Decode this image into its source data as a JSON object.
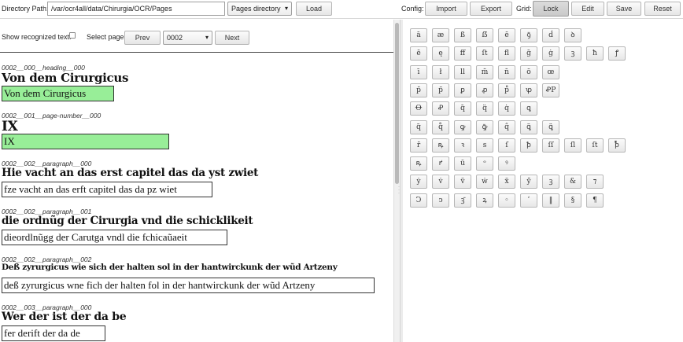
{
  "toolbar": {
    "dir_label": "Directory Path:",
    "dir_value": "/var/ocr4all/data/Chirurgia/OCR/Pages",
    "pages_dir_select": "Pages directory",
    "load_label": "Load",
    "config_label": "Config:",
    "import_label": "Import",
    "export_label": "Export",
    "grid_label": "Grid:",
    "lock_label": "Lock",
    "edit_label": "Edit",
    "save_label": "Save",
    "reset_label": "Reset"
  },
  "controls": {
    "show_recognized_label": "Show recognized text:",
    "select_page_label": "Select page:",
    "prev_label": "Prev",
    "page_value": "0002",
    "next_label": "Next"
  },
  "lines": [
    {
      "id": "0002__000__heading__000",
      "image_text": "Von dem Cirurgicus",
      "text": "Von dem Cirurgicus",
      "correct": true
    },
    {
      "id": "0002__001__page-number__000",
      "image_text": "IX",
      "text": "IX",
      "correct": true
    },
    {
      "id": "0002__002__paragraph__000",
      "image_text": "Hie vacht an das erst capitel das da yst zwiet",
      "text": "fze vacht an das erft capitel das da pz wiet",
      "correct": false
    },
    {
      "id": "0002__002__paragraph__001",
      "image_text": "die ordnũg der Cirurgia vnd die schicklikeit",
      "text": "dieordlnũgg der Carutga vndl die fchicaũaeit",
      "correct": false
    },
    {
      "id": "0002__002__paragraph__002",
      "image_text": "Deß zyrurgicus wie sich der halten sol in der hantwirckunk der wũd Artzeny",
      "text": "deß zyrurgicus wne fich der halten fol in der hantwirckunk der wũd Artzeny",
      "correct": false
    },
    {
      "id": "0002__003__paragraph__000",
      "image_text": "Wer der ist der da be",
      "text": "fer derift der da de",
      "correct": false
    }
  ],
  "grid_rows": [
    [
      "ā",
      "æ",
      "ß",
      "ẞ",
      "ē",
      "ꝯ̄",
      "ḋ",
      "ꝺ"
    ],
    [
      "ē",
      "ę",
      "ff",
      "ſt",
      "ﬂ",
      "ḡ",
      "ġ",
      "ꝫ",
      "ħ",
      "ꝭ"
    ],
    [
      "ī",
      "ł",
      "ll",
      "m̄",
      "n̄",
      "ō",
      "œ"
    ],
    [
      "p̄",
      "p̃",
      "ꝑ",
      "ꝓ",
      "p̊",
      "ꝕ",
      "ꝒP"
    ],
    [
      "Ꝋ",
      "Ꝓ",
      "q̄",
      "q̈",
      "q̇",
      "ꝗ"
    ],
    [
      "q̃",
      "q̊",
      "ꝙ",
      "ꝙ̄",
      "q̋",
      "ꝗ̃",
      "ꝗ̈"
    ],
    [
      "r̄",
      "ꝶ",
      "ꝛ",
      "s",
      "ſ",
      "ꝥ",
      "ſſ",
      "ſl",
      "ſt",
      "ꝥ̄"
    ],
    [
      "ꝶ",
      "ꝵ",
      "ū",
      "ᵒ",
      "ꝰ"
    ],
    [
      "ẏ",
      "v̇",
      "v̈",
      "ẇ",
      "ẍ",
      "ẏ̄",
      "ꝫ",
      "&",
      "⁊"
    ],
    [
      "Ↄ",
      "ↄ",
      "ꝫ̄",
      "ꝝ",
      "◦",
      "ʹ",
      "‖",
      "§",
      "¶"
    ]
  ]
}
